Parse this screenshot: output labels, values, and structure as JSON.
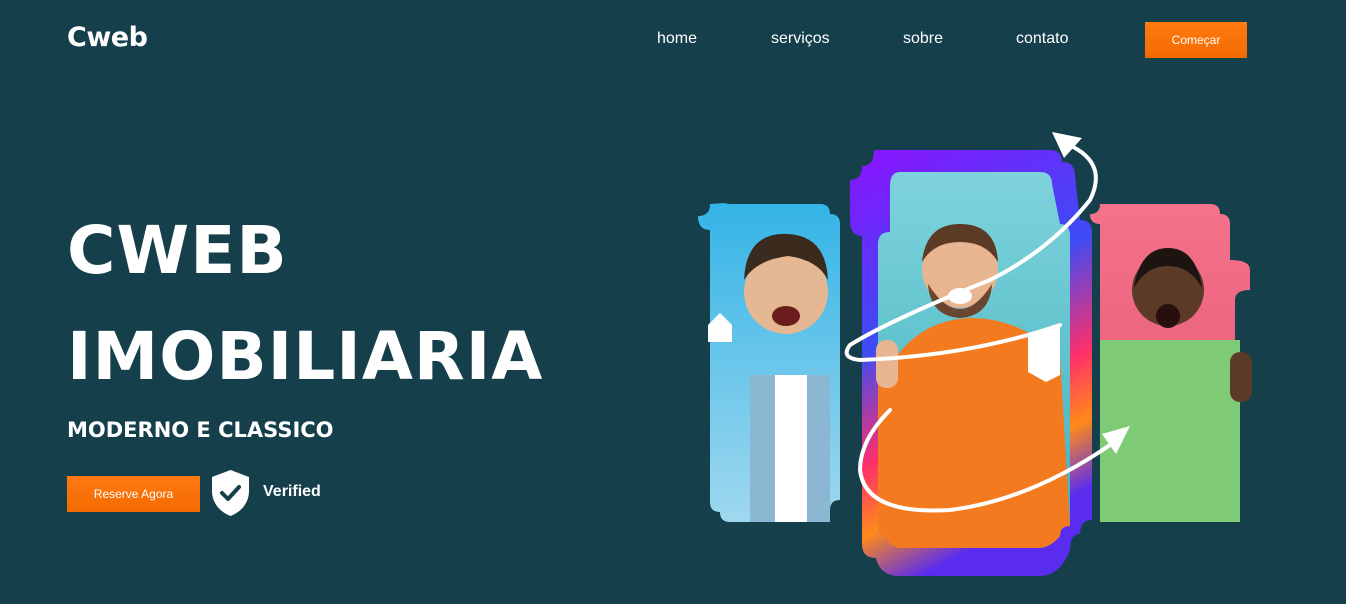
{
  "brand": {
    "logo": "Cweb"
  },
  "nav": {
    "items": [
      {
        "label": "home"
      },
      {
        "label": "serviços"
      },
      {
        "label": "sobre"
      },
      {
        "label": "contato"
      }
    ],
    "cta_label": "Começar"
  },
  "hero": {
    "title_line1": "CWEB",
    "title_line2": "IMOBILIARIA",
    "subtitle": "MODERNO E CLASSICO",
    "reserve_label": "Reserve Agora",
    "verified_label": "Verified"
  },
  "colors": {
    "background": "#153f4b",
    "accent": "#f57000",
    "text": "#ffffff"
  }
}
